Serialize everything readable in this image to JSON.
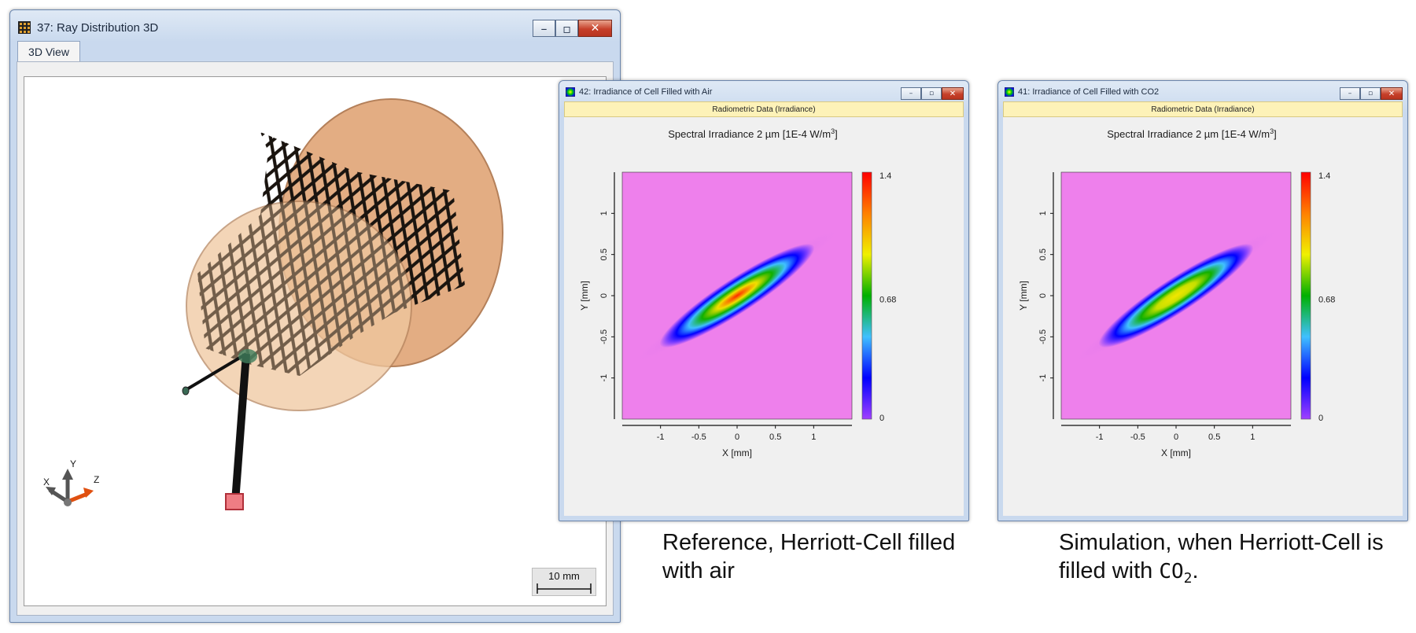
{
  "windows": {
    "ray3d": {
      "title": "37: Ray Distribution 3D",
      "tab": "3D View",
      "scale_bar": "10 mm",
      "axes": {
        "x": "X",
        "y": "Y",
        "z": "Z"
      }
    },
    "air": {
      "title": "42: Irradiance of Cell Filled with Air",
      "header": "Radiometric Data (Irradiance)",
      "chart_title": "Spectral Irradiance 2 µm  [1E-4 W/m",
      "chart_title_sup": "3",
      "chart_title_end": "]",
      "peak_color": "#ff2a00"
    },
    "co2": {
      "title": "41: Irradiance of Cell Filled with CO2",
      "header": "Radiometric Data (Irradiance)",
      "chart_title": "Spectral Irradiance 2 µm  [1E-4 W/m",
      "chart_title_sup": "3",
      "chart_title_end": "]",
      "peak_color": "#f2e600"
    }
  },
  "window_controls": {
    "minimize": "–",
    "maximize": "▫",
    "close": "✕"
  },
  "colors": {
    "background_magenta": "#ee80ec",
    "frame_beige": "#e9b58a",
    "colorbar": [
      "#a040ff",
      "#0000ff",
      "#40c0ff",
      "#00b000",
      "#f0f000",
      "#ff8000",
      "#ff0000"
    ]
  },
  "chart_data": [
    {
      "type": "heatmap",
      "title": "Spectral Irradiance 2 µm  [1E-4 W/m3]",
      "xlabel": "X [mm]",
      "ylabel": "Y [mm]",
      "xticks": [
        "-1",
        "-0.5",
        "0",
        "0.5",
        "1"
      ],
      "yticks": [
        "1",
        "0.5",
        "0",
        "-0.5",
        "-1"
      ],
      "xlim": [
        -1.5,
        1.5
      ],
      "ylim": [
        -1.5,
        1.5
      ],
      "colorbar_ticks": [
        "1.4",
        "0.68",
        "0"
      ],
      "colorbar_range": [
        0,
        1.4
      ],
      "peak_value": 1.4
    },
    {
      "type": "heatmap",
      "title": "Spectral Irradiance 2 µm  [1E-4 W/m3]",
      "xlabel": "X [mm]",
      "ylabel": "Y [mm]",
      "xticks": [
        "-1",
        "-0.5",
        "0",
        "0.5",
        "1"
      ],
      "yticks": [
        "1",
        "0.5",
        "0",
        "-0.5",
        "-1"
      ],
      "xlim": [
        -1.5,
        1.5
      ],
      "ylim": [
        -1.5,
        1.5
      ],
      "colorbar_ticks": [
        "1.4",
        "0.68",
        "0"
      ],
      "colorbar_range": [
        0,
        1.4
      ],
      "peak_value": 0.95
    }
  ],
  "captions": {
    "air": "Reference, Herriott-Cell filled with air",
    "co2_prefix": "Simulation, when Herriott-Cell is filled with ",
    "co2_chem": "CO",
    "co2_sub": "2",
    "co2_suffix": "."
  }
}
